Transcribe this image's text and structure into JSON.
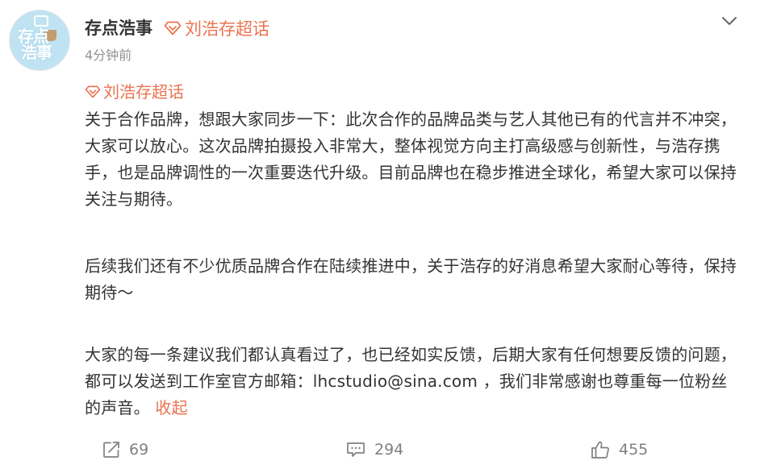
{
  "post": {
    "avatar_text_line1": "存点",
    "avatar_text_line2": "浩事",
    "username": "存点浩事",
    "topic_head": "刘浩存超话",
    "timestamp": "4分钟前",
    "body_topic": "刘浩存超话",
    "paragraph1": "关于合作品牌，想跟大家同步一下：此次合作的品牌品类与艺人其他已有的代言并不冲突，大家可以放心。这次品牌拍摄投入非常大，整体视觉方向主打高级感与创新性，与浩存携手，也是品牌调性的一次重要迭代升级。目前品牌也在稳步推进全球化，希望大家可以保持关注与期待。",
    "paragraph2": "后续我们还有不少优质品牌合作在陆续推进中，关于浩存的好消息希望大家耐心等待，保持期待～",
    "paragraph3": "大家的每一条建议我们都认真看过了，也已经如实反馈，后期大家有任何想要反馈的问题，都可以发送到工作室官方邮箱：lhcstudio@sina.com ，我们非常感谢也尊重每一位粉丝的声音。",
    "collapse_label": "收起"
  },
  "footer": {
    "reposts": "69",
    "comments": "294",
    "likes": "455"
  },
  "icons": {
    "topic": "diamond-icon",
    "menu": "chevron-down-icon",
    "repost": "share-icon",
    "comment": "comment-icon",
    "like": "thumbs-up-icon"
  },
  "colors": {
    "accent": "#eb7350",
    "text": "#333333",
    "muted": "#939393",
    "footer": "#808080"
  }
}
